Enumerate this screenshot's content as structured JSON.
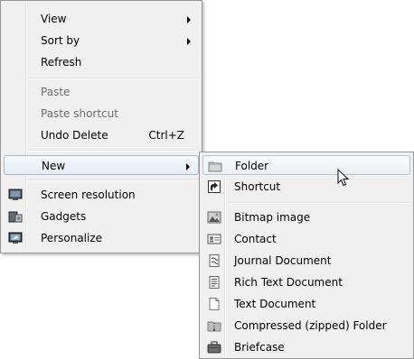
{
  "context_menu": {
    "view": "View",
    "sort_by": "Sort by",
    "refresh": "Refresh",
    "paste": "Paste",
    "paste_shortcut": "Paste shortcut",
    "undo_delete": "Undo Delete",
    "undo_shortcut": "Ctrl+Z",
    "new": "New",
    "screen_resolution": "Screen resolution",
    "gadgets": "Gadgets",
    "personalize": "Personalize"
  },
  "new_submenu": {
    "folder": "Folder",
    "shortcut": "Shortcut",
    "bitmap_image": "Bitmap image",
    "contact": "Contact",
    "journal_document": "Journal Document",
    "rich_text_document": "Rich Text Document",
    "text_document": "Text Document",
    "compressed_folder": "Compressed (zipped) Folder",
    "briefcase": "Briefcase"
  },
  "colors": {
    "menu_background": "#f0f0f0",
    "menu_border": "#979797",
    "disabled_text": "#6d6d6d",
    "highlight_border": "#a9b8d1"
  }
}
